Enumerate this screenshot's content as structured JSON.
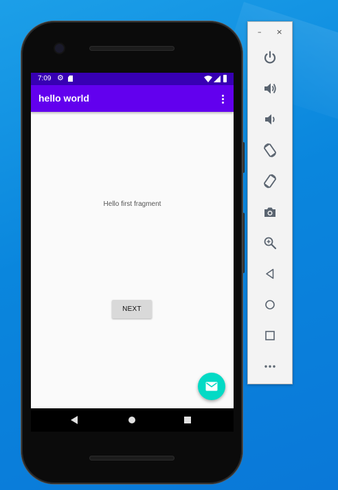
{
  "status_bar": {
    "time": "7:09",
    "bg": "#3700b3"
  },
  "app_bar": {
    "title": "hello world",
    "bg": "#6200ee"
  },
  "content": {
    "fragment_text": "Hello first fragment",
    "next_button_label": "NEXT"
  },
  "fab": {
    "icon": "mail-icon",
    "color": "#03dac5"
  },
  "emulator_toolbar": {
    "minimize": "–",
    "close": "×",
    "items": [
      "power-icon",
      "volume-up-icon",
      "volume-down-icon",
      "rotate-left-icon",
      "rotate-right-icon",
      "camera-icon",
      "zoom-icon",
      "back-icon",
      "home-icon",
      "overview-icon",
      "more-icon"
    ]
  }
}
